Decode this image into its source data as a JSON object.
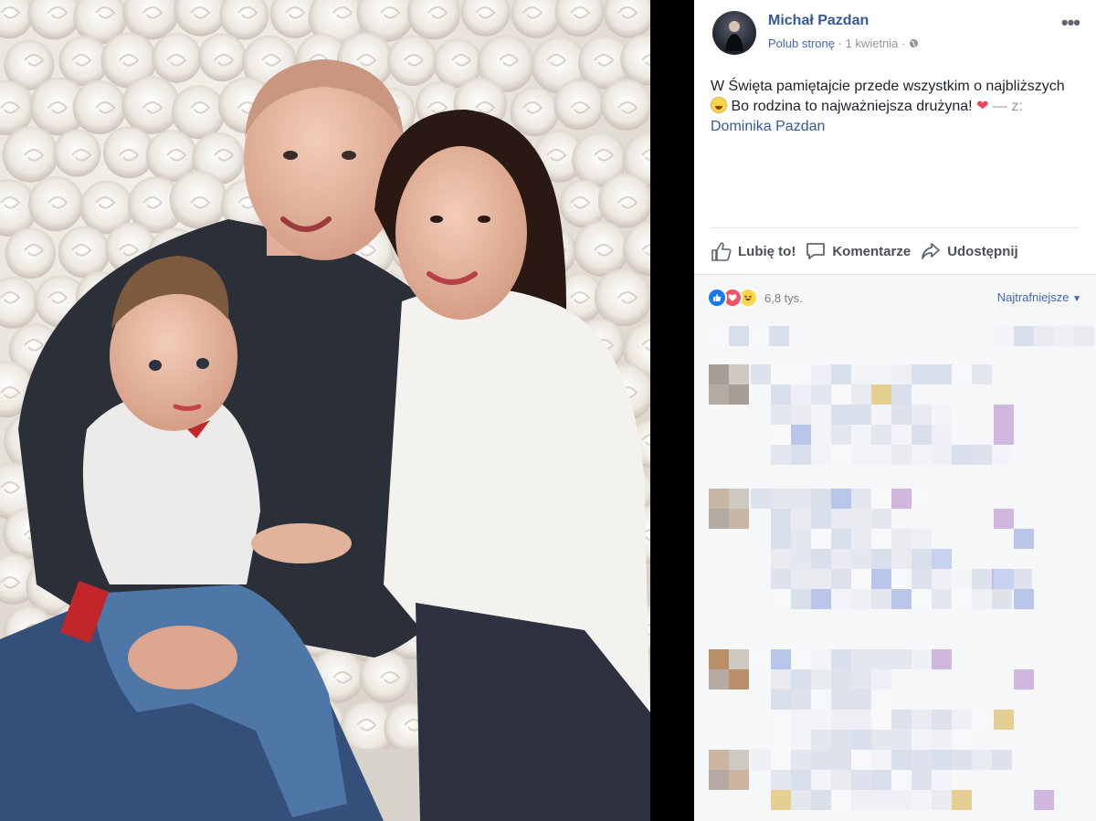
{
  "post": {
    "page_name": "Michał Pazdan",
    "like_page": "Polub stronę",
    "date": "1 kwietnia",
    "separator": "·",
    "text_part1": "W Święta pamiętajcie przede wszystkim o najbliższych",
    "text_part2": "Bo rodzina to najważniejsza drużyna!",
    "with_prefix": "— z:",
    "tagged_person": "Dominika Pazdan"
  },
  "actions": {
    "like": "Lubię to!",
    "comment": "Komentarze",
    "share": "Udostępnij"
  },
  "reactions": {
    "count": "6,8 tys.",
    "sort_label": "Najtrafniejsze"
  },
  "colors": {
    "link_blue": "#365899",
    "action_gray": "#4b4f56",
    "like_blue": "#1877f2",
    "love_red": "#f25268",
    "haha_yellow": "#fcd54a"
  },
  "icons": [
    "more-icon",
    "globe-icon",
    "grinning-emoji-icon",
    "heart-icon",
    "thumbs-up-icon",
    "comment-icon",
    "share-icon",
    "like-reaction-icon",
    "love-reaction-icon",
    "haha-reaction-icon",
    "caret-down-icon"
  ]
}
